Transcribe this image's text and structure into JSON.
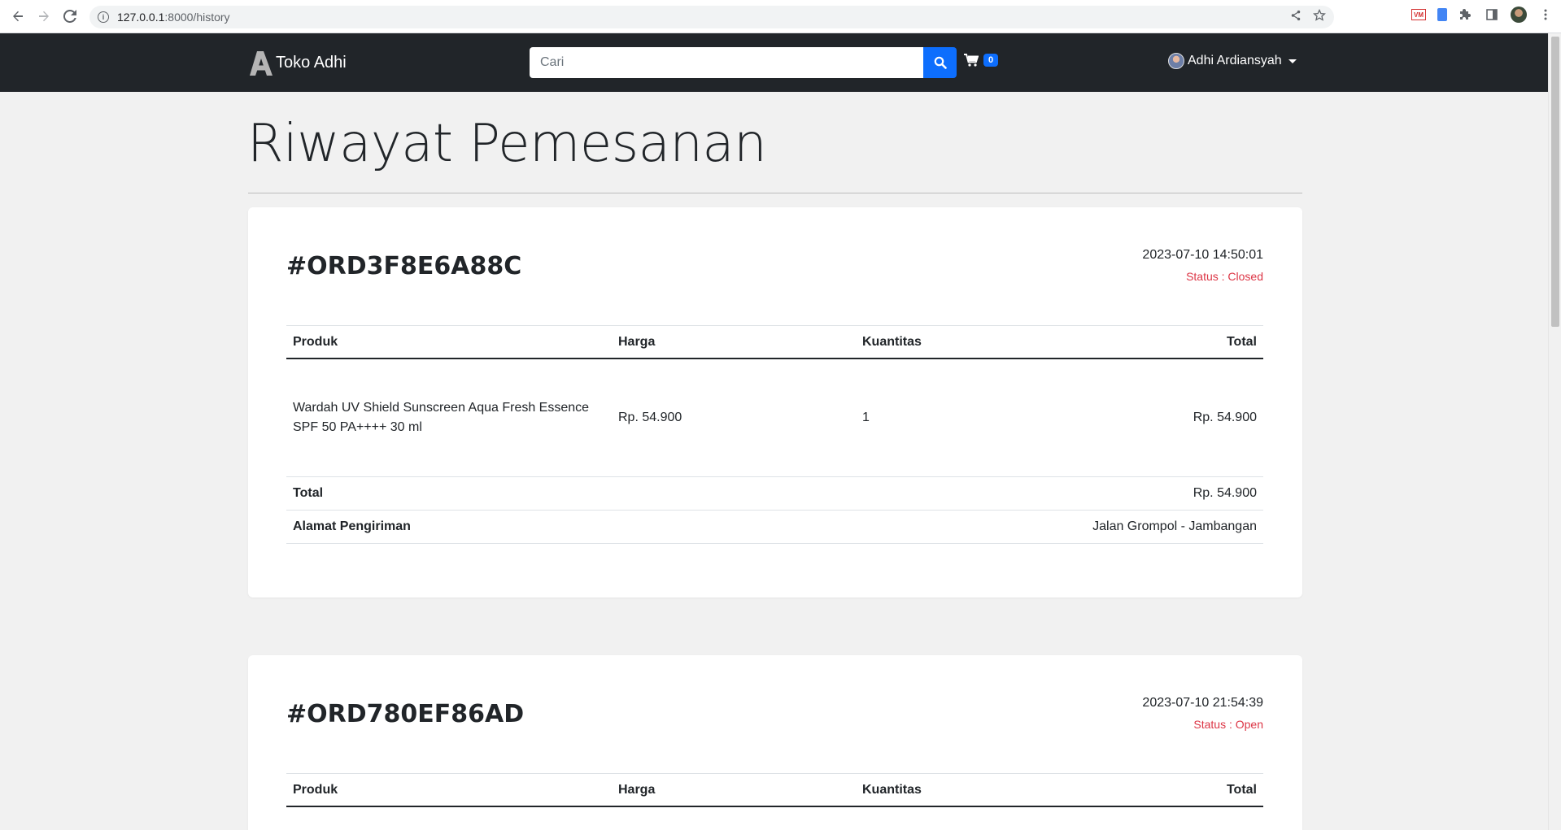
{
  "browser": {
    "url_host": "127.0.0.1",
    "url_path": ":8000/history",
    "extensions": [
      "share-icon",
      "star-icon",
      "vm-extension-icon",
      "document-extension-icon",
      "puzzle-icon",
      "sidebar-icon",
      "profile-avatar",
      "more-icon"
    ]
  },
  "navbar": {
    "brand": "Toko Adhi",
    "search_placeholder": "Cari",
    "cart_count": "0",
    "user_name": "Adhi Ardiansyah"
  },
  "page": {
    "title": "Riwayat Pemesanan"
  },
  "table_headers": {
    "product": "Produk",
    "price": "Harga",
    "quantity": "Kuantitas",
    "total": "Total"
  },
  "orders": [
    {
      "id": "#ORD3F8E6A88C",
      "date": "2023-07-10 14:50:01",
      "status": "Status : Closed",
      "items": [
        {
          "product": "Wardah UV Shield Sunscreen Aqua Fresh Essence SPF 50 PA++++ 30 ml",
          "price": "Rp. 54.900",
          "quantity": "1",
          "total": "Rp. 54.900"
        }
      ],
      "total_label": "Total",
      "total_value": "Rp. 54.900",
      "address_label": "Alamat Pengiriman",
      "address_value": "Jalan Grompol - Jambangan"
    },
    {
      "id": "#ORD780EF86AD",
      "date": "2023-07-10 21:54:39",
      "status": "Status : Open"
    }
  ],
  "colors": {
    "navbar_bg": "#212529",
    "primary": "#0d6efd",
    "status_red": "#dc3545",
    "page_bg": "#f1f1f1"
  }
}
